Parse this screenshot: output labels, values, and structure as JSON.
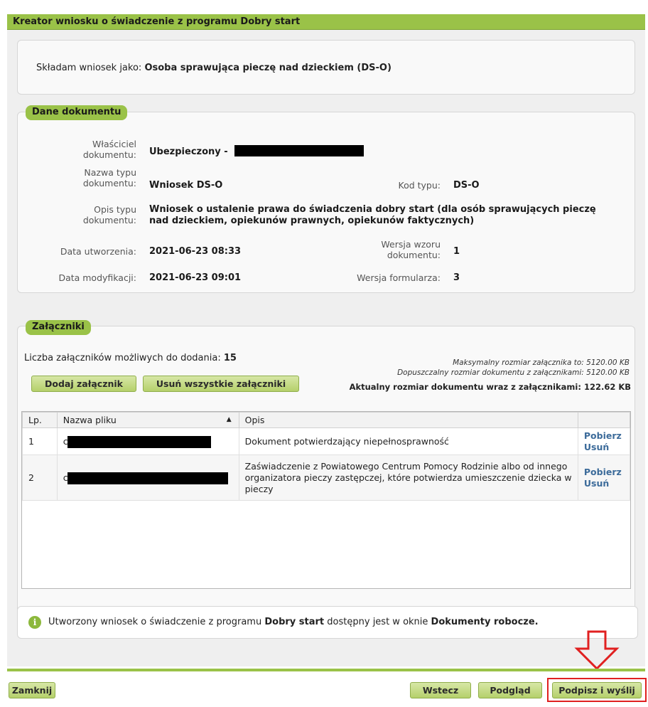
{
  "window": {
    "title": "Kreator wniosku o świadczenie z programu Dobry start"
  },
  "role": {
    "label": "Składam wniosek jako:",
    "value": "Osoba sprawująca pieczę nad dzieckiem (DS-O)"
  },
  "dane": {
    "legend": "Dane dokumentu",
    "owner_label_1": "Właściciel",
    "owner_label_2": "dokumentu:",
    "owner_value": "Ubezpieczony -",
    "type_name_label_1": "Nazwa typu",
    "type_name_label_2": "dokumentu:",
    "type_name_value": "Wniosek DS-O",
    "type_code_label": "Kod typu:",
    "type_code_value": "DS-O",
    "desc_label_1": "Opis typu",
    "desc_label_2": "dokumentu:",
    "desc_value_1": "Wniosek o ustalenie prawa do świadczenia dobry start (dla osób sprawujących pieczę",
    "desc_value_2": "nad dzieckiem, opiekunów prawnych, opiekunów faktycznych)",
    "created_label": "Data utworzenia:",
    "created_value": "2021-06-23 08:33",
    "template_version_label_1": "Wersja wzoru",
    "template_version_label_2": "dokumentu:",
    "template_version_value": "1",
    "modified_label": "Data modyfikacji:",
    "modified_value": "2021-06-23 09:01",
    "form_version_label": "Wersja formularza:",
    "form_version_value": "3"
  },
  "zalaczniki": {
    "legend": "Załączniki",
    "count_label": "Liczba załączników możliwych do dodania:",
    "count_value": "15",
    "max_attachment": "Maksymalny rozmiar załącznika to: 5120.00 KB",
    "max_document": "Dopuszczalny rozmiar dokumentu z załącznikami: 5120.00 KB",
    "current_size": "Aktualny rozmiar dokumentu wraz z załącznikami: 122.62 KB",
    "add_button": "Dodaj załącznik",
    "remove_all_button": "Usuń wszystkie załączniki",
    "columns": [
      "Lp.",
      "Nazwa pliku",
      "Opis"
    ],
    "sort_indicator": "▲",
    "rows": [
      {
        "lp": "1",
        "name_visible": "c",
        "opis": "Dokument potwierdzający niepełnosprawność",
        "download": "Pobierz",
        "remove": "Usuń"
      },
      {
        "lp": "2",
        "name_visible": "c",
        "opis": "Zaświadczenie z Powiatowego Centrum Pomocy Rodzinie albo od innego organizatora pieczy zastępczej, które potwierdza umieszczenie dziecka w pieczy",
        "download": "Pobierz",
        "remove": "Usuń"
      }
    ]
  },
  "info": {
    "icon": "info-icon",
    "text_1": "Utworzony wniosek o świadczenie z programu",
    "bold_1": "Dobry start",
    "text_2": "dostępny jest w oknie",
    "bold_2": "Dokumenty robocze."
  },
  "footer": {
    "close_button": "Zamknij",
    "back_button": "Wstecz",
    "preview_button": "Podgląd",
    "sign_button": "Podpisz i wyślij"
  },
  "colors": {
    "accent_green": "#9ac248",
    "annotation_red": "#e02020"
  }
}
